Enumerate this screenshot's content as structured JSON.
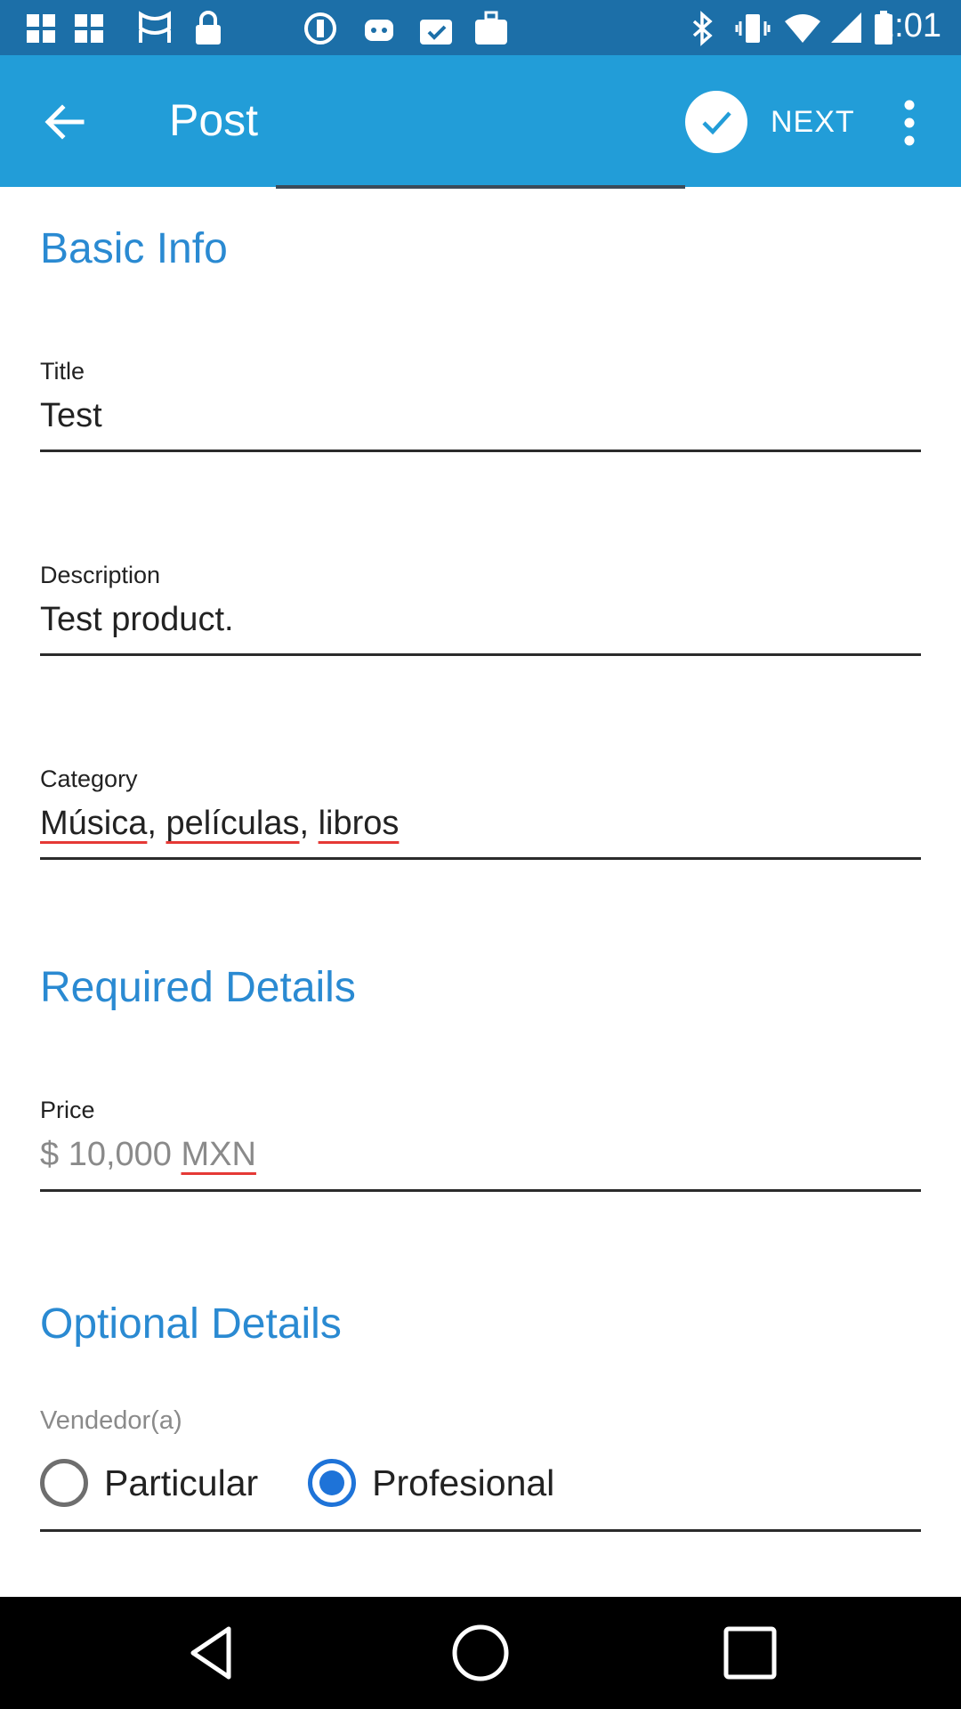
{
  "status_bar": {
    "time": "2:01",
    "icons": [
      "pinwheel-icon",
      "pinwheel-icon",
      "vpn-icon",
      "lock-icon",
      "app-icon",
      "android-icon",
      "checkbag-icon",
      "bag-icon",
      "bluetooth-icon",
      "vibrate-icon",
      "wifi-icon",
      "signal-icon",
      "battery-icon"
    ]
  },
  "toolbar": {
    "title": "Post",
    "next_label": "NEXT",
    "background": "#229dd8"
  },
  "sections": {
    "basic": "Basic Info",
    "required": "Required Details",
    "optional": "Optional Details"
  },
  "fields": {
    "title": {
      "label": "Title",
      "value": "Test"
    },
    "description": {
      "label": "Description",
      "value": "Test product."
    },
    "category": {
      "label": "Category",
      "parts": [
        "Música",
        ", ",
        "películas",
        ", ",
        "libros"
      ]
    },
    "price": {
      "label": "Price",
      "prefix": "$ 10,000 ",
      "currency": "MXN"
    }
  },
  "vendor": {
    "label": "Vendedor(a)",
    "options": [
      {
        "label": "Particular",
        "checked": false
      },
      {
        "label": "Profesional",
        "checked": true
      }
    ]
  },
  "colors": {
    "accent": "#2a8ad2",
    "radio_checked": "#1e73d8",
    "spellcheck": "#e53935"
  }
}
